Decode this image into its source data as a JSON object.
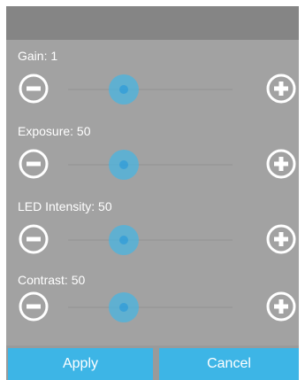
{
  "controls": [
    {
      "label": "Gain: 1",
      "value_fraction": 0.34
    },
    {
      "label": "Exposure: 50",
      "value_fraction": 0.34
    },
    {
      "label": "LED Intensity: 50",
      "value_fraction": 0.34
    },
    {
      "label": "Contrast: 50",
      "value_fraction": 0.34
    }
  ],
  "buttons": {
    "apply": "Apply",
    "cancel": "Cancel"
  },
  "icons": {
    "decrease": "minus-circle-icon",
    "increase": "plus-circle-icon"
  },
  "colors": {
    "panel": "#a2a2a2",
    "header": "#858585",
    "accent": "#3db5e6",
    "thumb": "#3cb9eb"
  }
}
